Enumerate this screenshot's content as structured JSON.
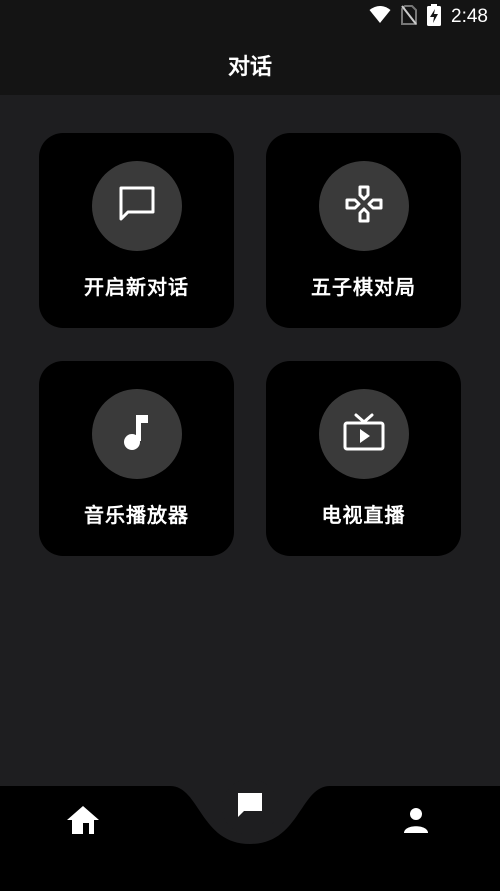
{
  "status_bar": {
    "time": "2:48",
    "icons": [
      "wifi-icon",
      "no-sim-icon",
      "battery-charging-icon"
    ]
  },
  "header": {
    "title": "对话"
  },
  "cards": [
    {
      "label": "开启新对话",
      "icon": "chat-bubble-icon"
    },
    {
      "label": "五子棋对局",
      "icon": "gamepad-icon"
    },
    {
      "label": "音乐播放器",
      "icon": "music-note-icon"
    },
    {
      "label": "电视直播",
      "icon": "tv-play-icon"
    }
  ],
  "bottom_nav": {
    "items": [
      {
        "name": "home",
        "icon": "home-icon"
      },
      {
        "name": "chat",
        "icon": "chat-icon",
        "active": true
      },
      {
        "name": "profile",
        "icon": "person-icon"
      }
    ]
  },
  "colors": {
    "background": "#1e1e20",
    "header": "#141414",
    "card": "#000000",
    "icon_circle": "#3a3a3a",
    "text": "#ffffff"
  }
}
